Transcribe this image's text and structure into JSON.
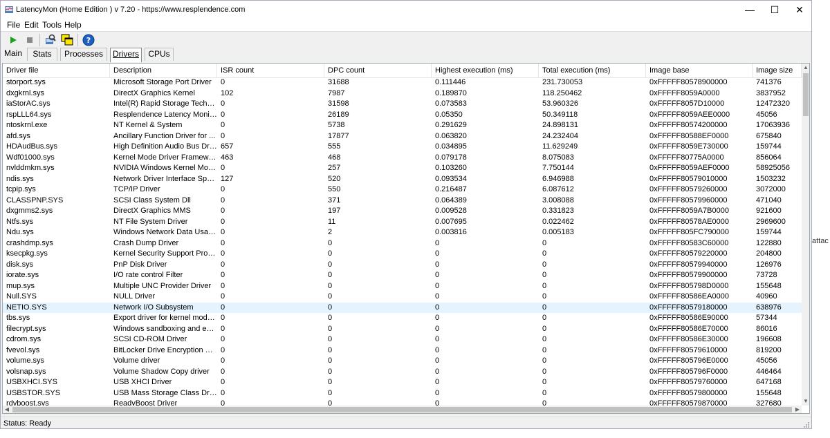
{
  "window": {
    "title": "LatencyMon  (Home Edition )  v 7.20 - https://www.resplendence.com",
    "minimize_glyph": "—",
    "maximize_glyph": "☐",
    "close_glyph": "✕"
  },
  "menu": [
    "File",
    "Edit",
    "Tools",
    "Help"
  ],
  "toolbar": {
    "icons": [
      "play-icon",
      "stop-icon",
      "search-driver-icon",
      "windows-icon",
      "help-icon"
    ]
  },
  "tabs": [
    "Main",
    "Stats",
    "Processes",
    "Drivers",
    "CPUs"
  ],
  "active_tab": "Drivers",
  "table": {
    "columns": [
      "Driver file",
      "Description",
      "ISR count",
      "DPC count",
      "Highest execution (ms)",
      "Total execution (ms)",
      "Image base",
      "Image size"
    ],
    "selected_row": 21,
    "rows": [
      [
        "storport.sys",
        "Microsoft Storage Port Driver",
        "0",
        "31688",
        "0.111446",
        "231.730053",
        "0xFFFFF80578900000",
        "741376"
      ],
      [
        "dxgkrnl.sys",
        "DirectX Graphics Kernel",
        "102",
        "7987",
        "0.189870",
        "118.250462",
        "0xFFFFF8059A0000",
        "3837952"
      ],
      [
        "iaStorAC.sys",
        "Intel(R) Rapid Storage Techno...",
        "0",
        "31598",
        "0.073583",
        "53.960326",
        "0xFFFFF8057D10000",
        "12472320"
      ],
      [
        "rspLLL64.sys",
        "Resplendence Latency Monit...",
        "0",
        "26189",
        "0.05350",
        "50.349118",
        "0xFFFFF8059AEE0000",
        "45056"
      ],
      [
        "ntoskrnl.exe",
        "NT Kernel & System",
        "0",
        "5738",
        "0.291629",
        "24.898131",
        "0xFFFFF80574200000",
        "17063936"
      ],
      [
        "afd.sys",
        "Ancillary Function Driver for ...",
        "0",
        "17877",
        "0.063820",
        "24.232404",
        "0xFFFFF80588EF0000",
        "675840"
      ],
      [
        "HDAudBus.sys",
        "High Definition Audio Bus Driver",
        "657",
        "555",
        "0.034895",
        "11.629249",
        "0xFFFFF8059E730000",
        "159744"
      ],
      [
        "Wdf01000.sys",
        "Kernel Mode Driver Framewor...",
        "463",
        "468",
        "0.079178",
        "8.075083",
        "0xFFFFF80775A0000",
        "856064"
      ],
      [
        "nvlddmkm.sys",
        "NVIDIA Windows Kernel Mod...",
        "0",
        "257",
        "0.103260",
        "7.750144",
        "0xFFFFF8059AEF0000",
        "58925056"
      ],
      [
        "ndis.sys",
        "Network Driver Interface Speci...",
        "127",
        "520",
        "0.093534",
        "6.946988",
        "0xFFFFF80579010000",
        "1503232"
      ],
      [
        "tcpip.sys",
        "TCP/IP Driver",
        "0",
        "550",
        "0.216487",
        "6.087612",
        "0xFFFFF80579260000",
        "3072000"
      ],
      [
        "CLASSPNP.SYS",
        "SCSI Class System Dll",
        "0",
        "371",
        "0.064389",
        "3.008088",
        "0xFFFFF80579960000",
        "471040"
      ],
      [
        "dxgmms2.sys",
        "DirectX Graphics MMS",
        "0",
        "197",
        "0.009528",
        "0.331823",
        "0xFFFFF8059A7B0000",
        "921600"
      ],
      [
        "Ntfs.sys",
        "NT File System Driver",
        "0",
        "11",
        "0.007695",
        "0.022462",
        "0xFFFFF80578AE0000",
        "2969600"
      ],
      [
        "Ndu.sys",
        "Windows Network Data Usag...",
        "0",
        "2",
        "0.003816",
        "0.005183",
        "0xFFFFF805FC790000",
        "159744"
      ],
      [
        "crashdmp.sys",
        "Crash Dump Driver",
        "0",
        "0",
        "0",
        "0",
        "0xFFFFF80583C60000",
        "122880"
      ],
      [
        "ksecpkg.sys",
        "Kernel Security Support Provi...",
        "0",
        "0",
        "0",
        "0",
        "0xFFFFF80579220000",
        "204800"
      ],
      [
        "disk.sys",
        "PnP Disk Driver",
        "0",
        "0",
        "0",
        "0",
        "0xFFFFF80579940000",
        "126976"
      ],
      [
        "iorate.sys",
        "I/O rate control Filter",
        "0",
        "0",
        "0",
        "0",
        "0xFFFFF80579900000",
        "73728"
      ],
      [
        "mup.sys",
        "Multiple UNC Provider Driver",
        "0",
        "0",
        "0",
        "0",
        "0xFFFFF805798D0000",
        "155648"
      ],
      [
        "Null.SYS",
        "NULL Driver",
        "0",
        "0",
        "0",
        "0",
        "0xFFFFF80586EA0000",
        "40960"
      ],
      [
        "NETIO.SYS",
        "Network I/O Subsystem",
        "0",
        "0",
        "0",
        "0",
        "0xFFFFF80579180000",
        "638976"
      ],
      [
        "tbs.sys",
        "Export driver for kernel mode ...",
        "0",
        "0",
        "0",
        "0",
        "0xFFFFF80586E90000",
        "57344"
      ],
      [
        "filecrypt.sys",
        "Windows sandboxing and enc...",
        "0",
        "0",
        "0",
        "0",
        "0xFFFFF80586E70000",
        "86016"
      ],
      [
        "cdrom.sys",
        "SCSI CD-ROM Driver",
        "0",
        "0",
        "0",
        "0",
        "0xFFFFF80586E30000",
        "196608"
      ],
      [
        "fvevol.sys",
        "BitLocker Drive Encryption Dri...",
        "0",
        "0",
        "0",
        "0",
        "0xFFFFF80579610000",
        "819200"
      ],
      [
        "volume.sys",
        "Volume driver",
        "0",
        "0",
        "0",
        "0",
        "0xFFFFF805796E0000",
        "45056"
      ],
      [
        "volsnap.sys",
        "Volume Shadow Copy driver",
        "0",
        "0",
        "0",
        "0",
        "0xFFFFF805796F0000",
        "446464"
      ],
      [
        "USBXHCI.SYS",
        "USB XHCI Driver",
        "0",
        "0",
        "0",
        "0",
        "0xFFFFF80579760000",
        "647168"
      ],
      [
        "USBSTOR.SYS",
        "USB Mass Storage Class Driver",
        "0",
        "0",
        "0",
        "0",
        "0xFFFFF80579800000",
        "155648"
      ],
      [
        "rdyboost.sys",
        "ReadyBoost Driver",
        "0",
        "0",
        "0",
        "0",
        "0xFFFFF80579870000",
        "327680"
      ]
    ]
  },
  "status": "Status: Ready",
  "background_text": "attac"
}
